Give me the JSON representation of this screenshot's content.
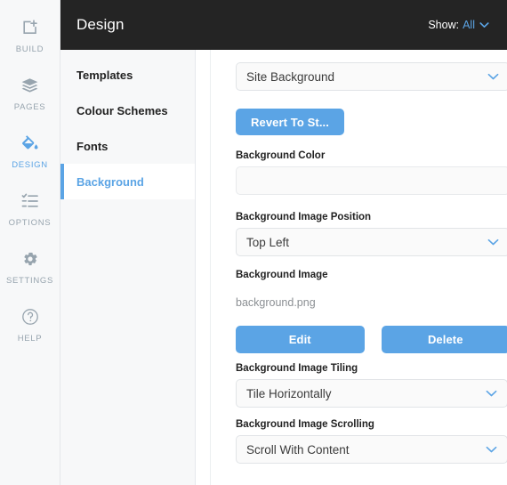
{
  "rail": {
    "items": [
      {
        "label": "BUILD",
        "icon": "add-page-icon",
        "active": false
      },
      {
        "label": "PAGES",
        "icon": "layers-icon",
        "active": false
      },
      {
        "label": "DESIGN",
        "icon": "paint-bucket-icon",
        "active": true
      },
      {
        "label": "OPTIONS",
        "icon": "checklist-icon",
        "active": false
      },
      {
        "label": "SETTINGS",
        "icon": "gear-icon",
        "active": false
      },
      {
        "label": "HELP",
        "icon": "question-circle-icon",
        "active": false
      }
    ]
  },
  "header": {
    "title": "Design",
    "show_label": "Show:",
    "show_value": "All",
    "caret_icon": "chevron-down-icon"
  },
  "subnav": {
    "items": [
      {
        "label": "Templates",
        "active": false
      },
      {
        "label": "Colour Schemes",
        "active": false
      },
      {
        "label": "Fonts",
        "active": false
      },
      {
        "label": "Background",
        "active": true
      }
    ]
  },
  "panel": {
    "scope_select": {
      "value": "Site Background",
      "caret_icon": "chevron-down-icon"
    },
    "revert_button": "Revert To St...",
    "background_color": {
      "label": "Background Color",
      "value": "",
      "placeholder": ""
    },
    "background_image_position": {
      "label": "Background Image Position",
      "value": "Top Left",
      "caret_icon": "chevron-down-icon"
    },
    "background_image": {
      "label": "Background Image",
      "filename": "background.png",
      "edit_button": "Edit",
      "delete_button": "Delete"
    },
    "background_image_tiling": {
      "label": "Background Image Tiling",
      "value": "Tile Horizontally",
      "caret_icon": "chevron-down-icon"
    },
    "background_image_scrolling": {
      "label": "Background Image Scrolling",
      "value": "Scroll With Content",
      "caret_icon": "chevron-down-icon"
    }
  },
  "colors": {
    "accent": "#5ba4e5",
    "header_bg": "#242424",
    "rail_bg": "#f7f8f9",
    "panel_bg": "#ffffff",
    "muted_text": "#97a4ae"
  }
}
